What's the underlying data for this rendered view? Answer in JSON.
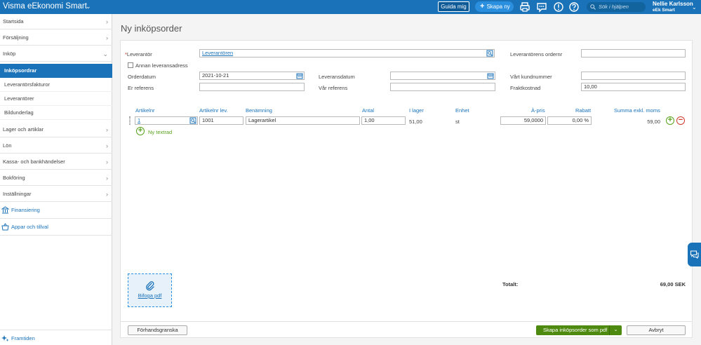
{
  "app": {
    "title": "Visma eEkonomi Smart"
  },
  "topbar": {
    "guide_label": "Guida mig",
    "create_label": "Skapa ny",
    "search_placeholder": "Sök i hjälpen",
    "user_name": "Nellie Karlsson",
    "user_company": "eEk Smart"
  },
  "sidebar": {
    "items": [
      {
        "label": "Startsida"
      },
      {
        "label": "Försäljning"
      },
      {
        "label": "Inköp"
      }
    ],
    "sub_items": [
      {
        "label": "Inköpsordrar"
      },
      {
        "label": "Leverantörsfakturor"
      },
      {
        "label": "Leverantörer"
      },
      {
        "label": "Bildunderlag"
      }
    ],
    "items2": [
      {
        "label": "Lager och artiklar"
      },
      {
        "label": "Lön"
      },
      {
        "label": "Kassa- och bankhändelser"
      },
      {
        "label": "Bokföring"
      },
      {
        "label": "Inställningar"
      }
    ],
    "links": [
      {
        "label": "Finansiering"
      },
      {
        "label": "Appar och tillval"
      }
    ],
    "bottom_link": "Framtiden"
  },
  "page": {
    "title": "Ny inköpsorder"
  },
  "form": {
    "supplier_label": "Leverantör",
    "supplier_required": "*",
    "supplier_value": "Leverantören",
    "other_address_label": "Annan leveransadress",
    "order_date_label": "Orderdatum",
    "order_date_value": "2021-10-21",
    "your_ref_label": "Er referens",
    "your_ref_value": "",
    "delivery_date_label": "Leveransdatum",
    "delivery_date_value": "",
    "our_ref_label": "Vår referens",
    "our_ref_value": "",
    "supplier_order_no_label": "Leverantörens ordernr",
    "supplier_order_no_value": "",
    "customer_no_label": "Vårt kundnummer",
    "customer_no_value": "",
    "freight_label": "Fraktkostnad",
    "freight_value": "10,00"
  },
  "table": {
    "headers": {
      "article_no": "Artikelnr",
      "supplier_article_no": "Artikelnr lev.",
      "description": "Benämning",
      "quantity": "Antal",
      "in_stock": "I lager",
      "unit": "Enhet",
      "unit_price": "À-pris",
      "discount": "Rabatt",
      "sum": "Summa exkl. moms"
    },
    "rows": [
      {
        "article_no": "1",
        "supplier_article_no": "1001",
        "description": "Lagerartikel",
        "quantity": "1,00",
        "in_stock": "51,00",
        "unit": "st",
        "unit_price": "59,0000",
        "discount": "0,00 %",
        "sum": "59,00"
      }
    ],
    "new_row_label": "Ny textrad"
  },
  "attachment": {
    "label": "Bifoga pdf"
  },
  "totals": {
    "label": "Totalt:",
    "value": "69,00 SEK"
  },
  "footer": {
    "preview_label": "Förhandsgranska",
    "create_label": "Skapa inköpsorder som pdf",
    "cancel_label": "Avbryt"
  },
  "colors": {
    "brand": "#1a72b8",
    "primary_action": "#4f8a10",
    "add": "#58a11b",
    "remove": "#d0392b"
  }
}
